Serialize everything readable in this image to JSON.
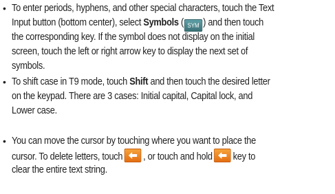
{
  "bullet_glyph": "•",
  "items": [
    {
      "lines": [
        {
          "before": "To enter periods, hyphens, and other special characters, touch the Text"
        },
        {
          "before": "Input button (bottom center), select ",
          "bold": "Symbols",
          "mid": " (",
          "key_label": "SYM",
          "after": ") and then touch"
        },
        {
          "before": "the corresponding key. If the symbol does not display on the initial"
        },
        {
          "before": "screen, touch the left or right arrow key to display the next set of"
        },
        {
          "before": "symbols."
        }
      ]
    },
    {
      "lines": [
        {
          "before": "To shift case in T9 mode, touch ",
          "bold": "Shift",
          "after": " and then touch the desired letter"
        },
        {
          "before": "on the keypad. There are 3 cases: Initial capital, Capital lock, and"
        },
        {
          "before": "Lower case."
        }
      ]
    },
    {
      "lines": [
        {
          "before": "You can move the cursor by touching where you want to place the"
        },
        {
          "before": "cursor. To delete letters, touch",
          "after": ", or touch and hold",
          "after2": "key to"
        },
        {
          "before": "clear the entire text string."
        }
      ]
    }
  ],
  "colors": {
    "text": "#222222",
    "sym_key": "#4a8a90",
    "backspace_key": "#f08a1f"
  },
  "icons": {
    "backspace": "left-arrow-backspace-icon",
    "sym": "sym-key-icon"
  }
}
